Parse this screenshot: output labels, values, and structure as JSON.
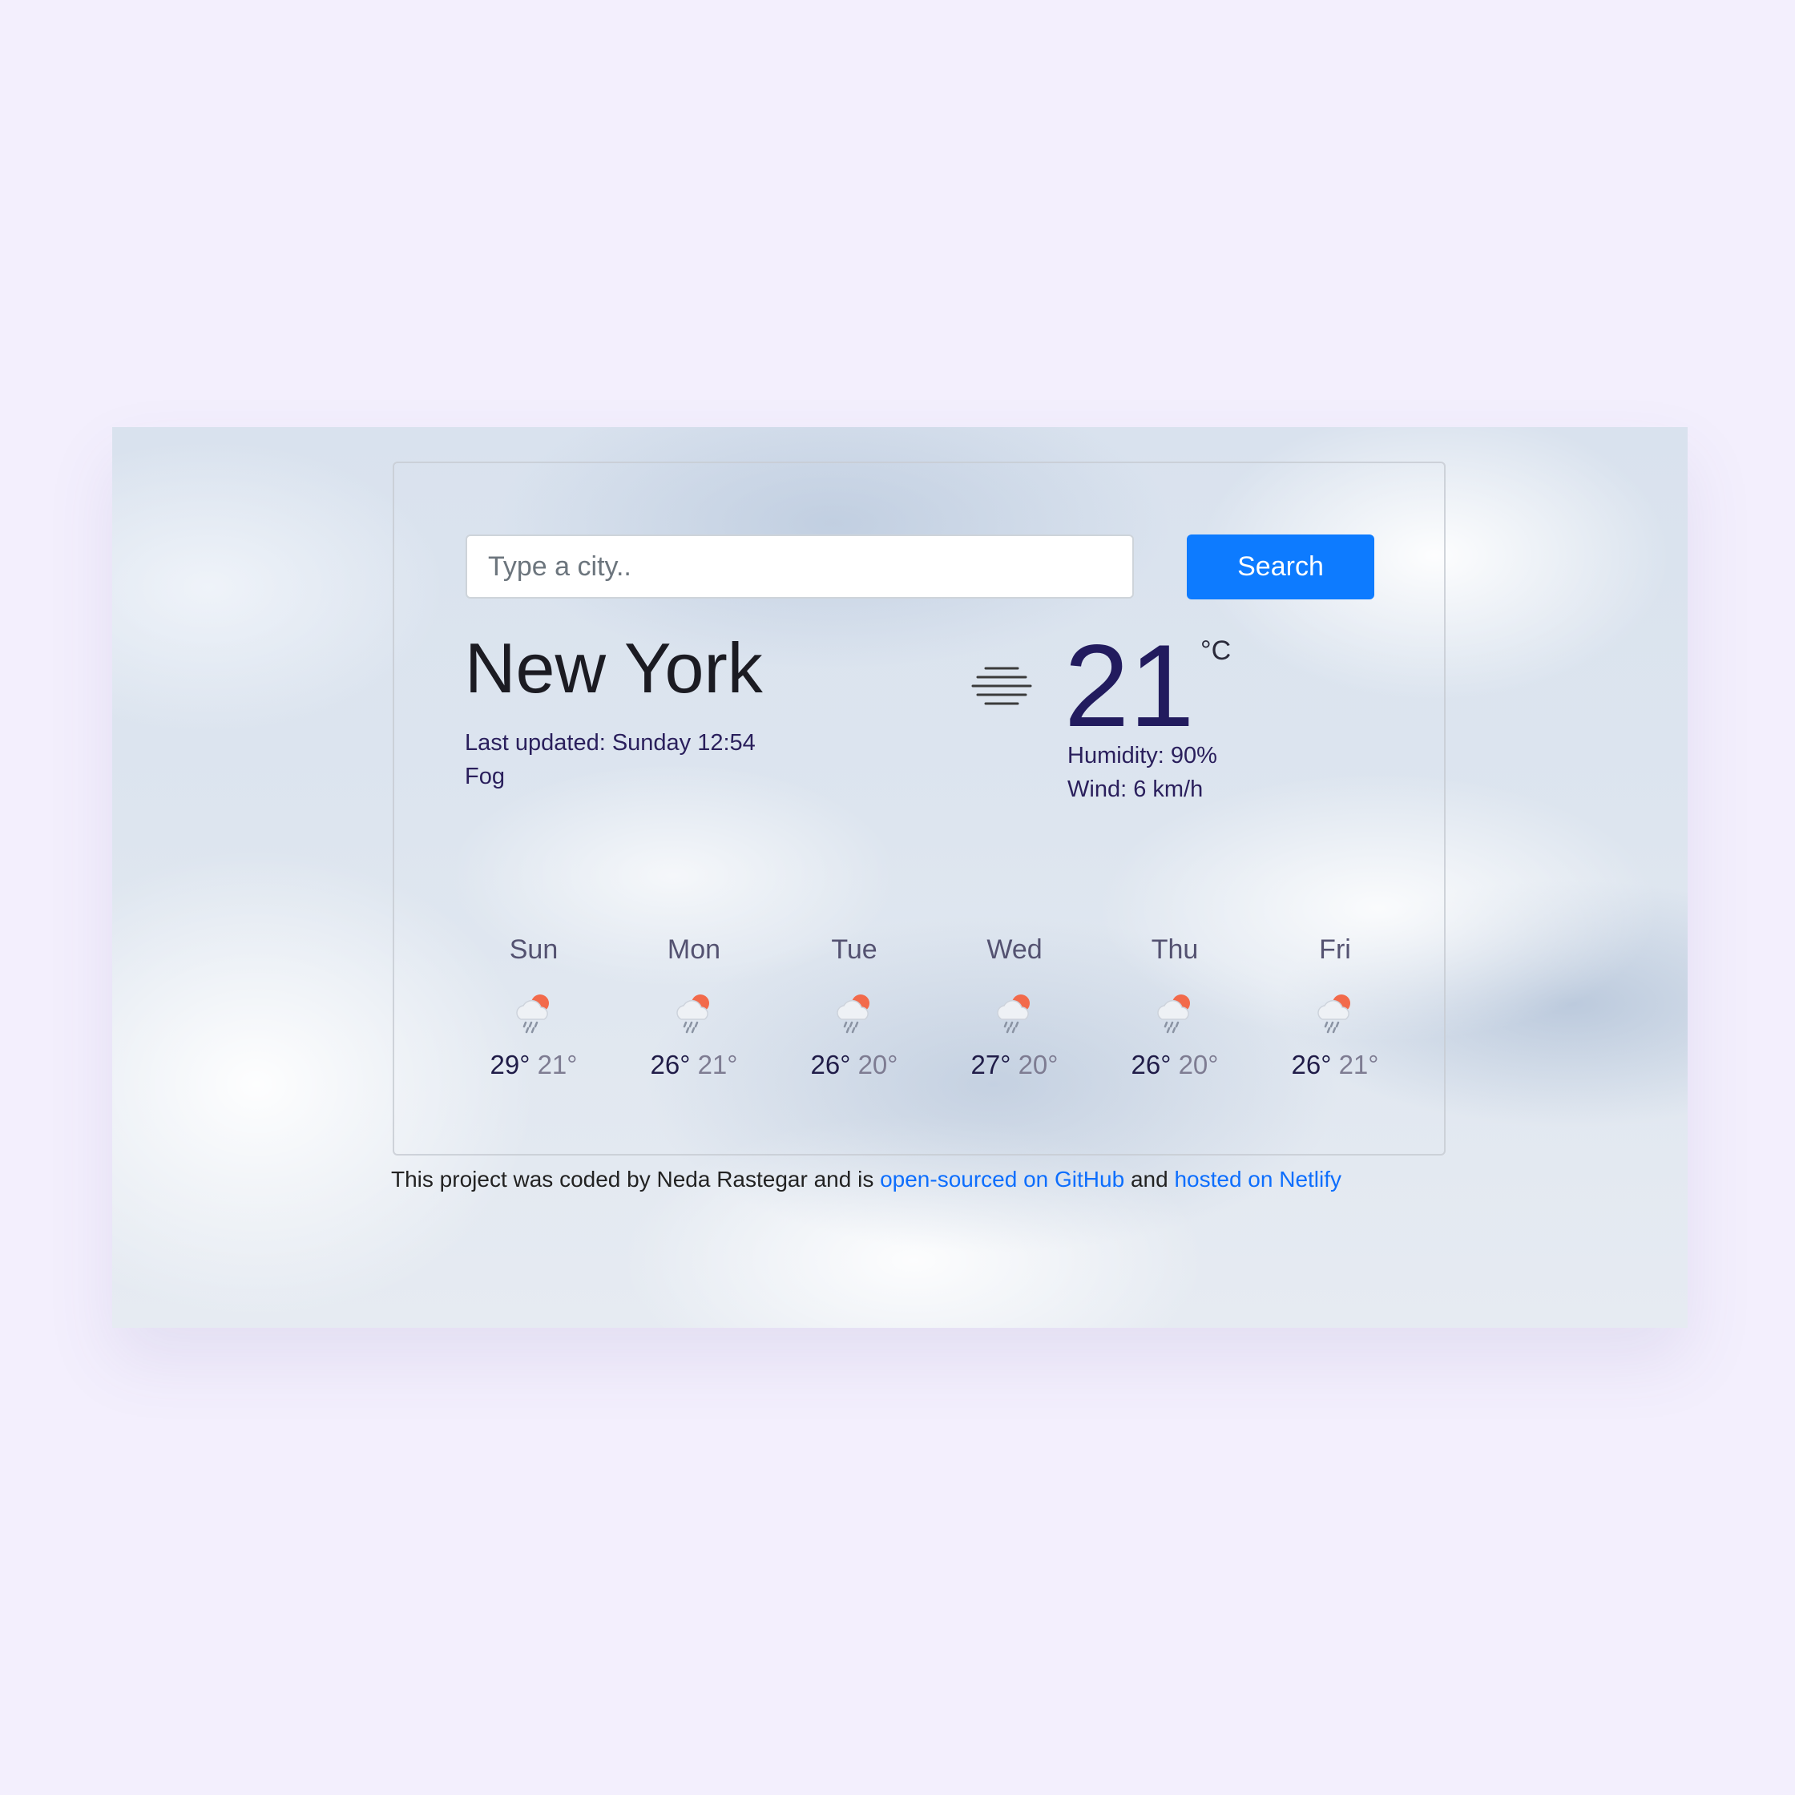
{
  "search": {
    "placeholder": "Type a city..",
    "value": "",
    "button_label": "Search"
  },
  "current": {
    "city": "New York",
    "last_updated_label": "Last updated: ",
    "last_updated": "Sunday 12:54",
    "description": "Fog",
    "icon": "fog-icon",
    "temperature": "21",
    "unit": "°C",
    "humidity_label": "Humidity: ",
    "humidity": "90%",
    "wind_label": "Wind: ",
    "wind": "6 km/h"
  },
  "forecast": [
    {
      "day": "Sun",
      "max": "29°",
      "min": "21°",
      "icon": "rain-sun-cloud-icon"
    },
    {
      "day": "Mon",
      "max": "26°",
      "min": "21°",
      "icon": "rain-sun-cloud-icon"
    },
    {
      "day": "Tue",
      "max": "26°",
      "min": "20°",
      "icon": "rain-sun-cloud-icon"
    },
    {
      "day": "Wed",
      "max": "27°",
      "min": "20°",
      "icon": "rain-sun-cloud-icon"
    },
    {
      "day": "Thu",
      "max": "26°",
      "min": "20°",
      "icon": "rain-sun-cloud-icon"
    },
    {
      "day": "Fri",
      "max": "26°",
      "min": "21°",
      "icon": "rain-sun-cloud-icon"
    }
  ],
  "footer": {
    "text_before": "This project was coded by Neda Rastegar and is ",
    "github_link": "open-sourced on GitHub",
    "text_middle": " and ",
    "netlify_link": "hosted on Netlify"
  },
  "colors": {
    "page_background": "#f3effd",
    "search_button": "#0d7bff",
    "link": "#0d6efd",
    "temperature": "#221b5e",
    "sun": "#f26a4b"
  }
}
